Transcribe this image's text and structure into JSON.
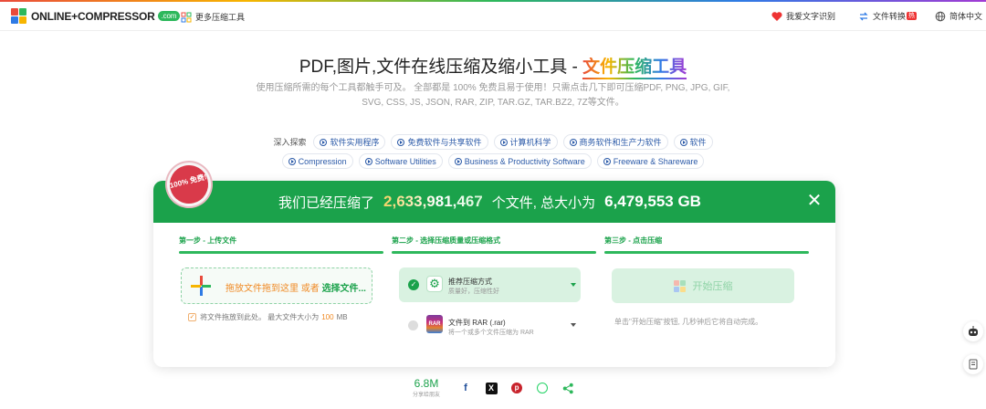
{
  "header": {
    "logo_text": "ONLINE+COMPRESSOR",
    "logo_badge": ".com",
    "more_tools": "更多压缩工具",
    "text_recognition": "我爱文字识别",
    "file_convert": "文件转换",
    "file_convert_badge": "热",
    "language": "简体中文"
  },
  "hero": {
    "title_main": "PDF,图片,文件在线压缩及缩小工具 - ",
    "title_highlight": "文件压缩工具",
    "subtitle": "使用压缩所需的每个工具都触手可及。 全部都是 100% 免费且易于使用！只需点击几下即可压缩PDF, PNG, JPG, GIF, SVG, CSS, JS, JSON, RAR, ZIP, TAR.GZ, TAR.BZ2, 7Z等文件。"
  },
  "explore": {
    "label": "深入探索",
    "row1": [
      "软件实用程序",
      "免费软件与共享软件",
      "计算机科学",
      "商务软件和生产力软件",
      "软件"
    ],
    "row2": [
      "Compression",
      "Software Utilities",
      "Business & Productivity Software",
      "Freeware & Shareware"
    ]
  },
  "stats": {
    "prefix": "我们已经压缩了",
    "files_count": "2,633,981,467",
    "middle": "个文件, 总大小为",
    "total_size": "6,479,553 GB",
    "badge": "100% 免费!"
  },
  "steps": {
    "step1_title": "第一步 - 上传文件",
    "step2_title": "第二步 - 选择压缩质量或压缩格式",
    "step3_title": "第三步 - 点击压缩",
    "drop_text": "拖放文件拖到这里",
    "drop_or": "或者",
    "drop_select": "选择文件...",
    "limit_prefix": "将文件拖放到此处。 最大文件大小为",
    "limit_value": "100",
    "limit_unit": "MB",
    "option1_title": "推荐压缩方式",
    "option1_sub": "质量好，压缩性好",
    "option2_title": "文件到 RAR (.rar)",
    "option2_sub": "将一个或多个文件压缩为 RAR",
    "start_button": "开始压缩",
    "hint": "单击\"开始压缩\"按钮, 几秒钟后它将自动完成。"
  },
  "share": {
    "count": "6.8M",
    "label": "分享给朋友"
  },
  "colors": {
    "brand_green": "#1ba24b",
    "accent_orange": "#f08a24",
    "link_blue": "#2b5aa8"
  }
}
